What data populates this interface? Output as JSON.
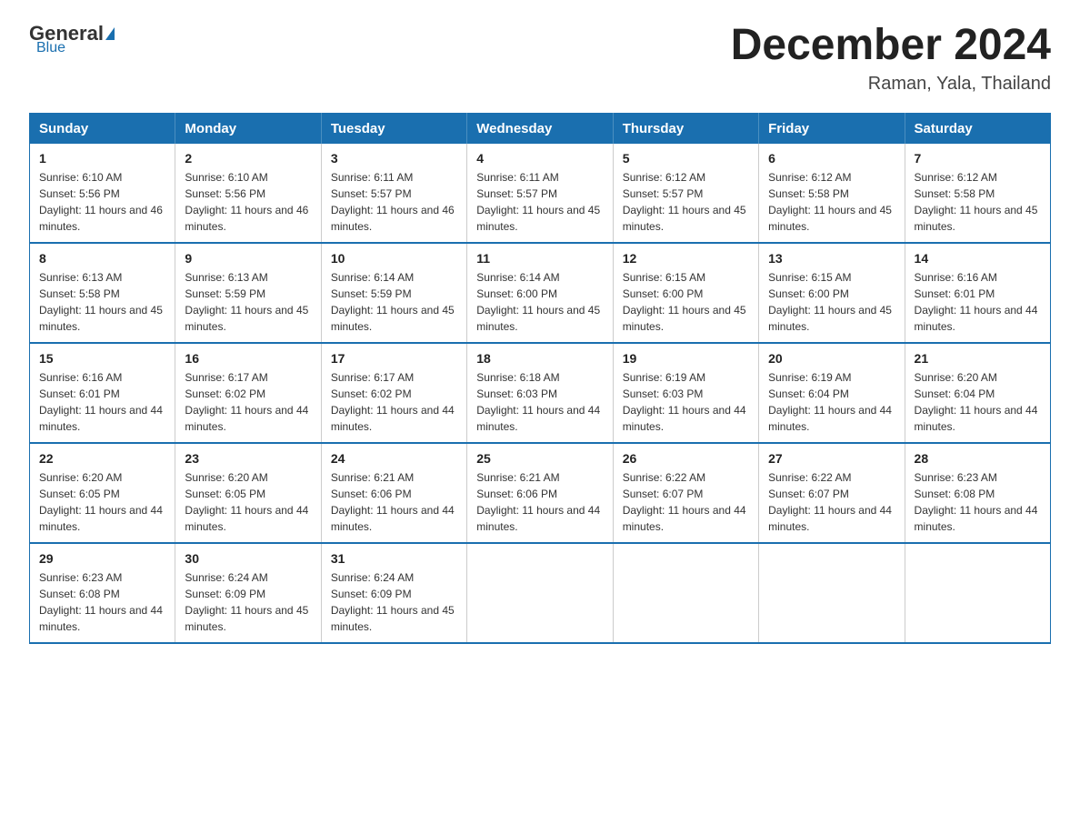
{
  "header": {
    "logo_general": "General",
    "logo_blue": "Blue",
    "month_title": "December 2024",
    "location": "Raman, Yala, Thailand"
  },
  "days_of_week": [
    "Sunday",
    "Monday",
    "Tuesday",
    "Wednesday",
    "Thursday",
    "Friday",
    "Saturday"
  ],
  "weeks": [
    [
      {
        "day": "1",
        "sunrise": "6:10 AM",
        "sunset": "5:56 PM",
        "daylight": "11 hours and 46 minutes."
      },
      {
        "day": "2",
        "sunrise": "6:10 AM",
        "sunset": "5:56 PM",
        "daylight": "11 hours and 46 minutes."
      },
      {
        "day": "3",
        "sunrise": "6:11 AM",
        "sunset": "5:57 PM",
        "daylight": "11 hours and 46 minutes."
      },
      {
        "day": "4",
        "sunrise": "6:11 AM",
        "sunset": "5:57 PM",
        "daylight": "11 hours and 45 minutes."
      },
      {
        "day": "5",
        "sunrise": "6:12 AM",
        "sunset": "5:57 PM",
        "daylight": "11 hours and 45 minutes."
      },
      {
        "day": "6",
        "sunrise": "6:12 AM",
        "sunset": "5:58 PM",
        "daylight": "11 hours and 45 minutes."
      },
      {
        "day": "7",
        "sunrise": "6:12 AM",
        "sunset": "5:58 PM",
        "daylight": "11 hours and 45 minutes."
      }
    ],
    [
      {
        "day": "8",
        "sunrise": "6:13 AM",
        "sunset": "5:58 PM",
        "daylight": "11 hours and 45 minutes."
      },
      {
        "day": "9",
        "sunrise": "6:13 AM",
        "sunset": "5:59 PM",
        "daylight": "11 hours and 45 minutes."
      },
      {
        "day": "10",
        "sunrise": "6:14 AM",
        "sunset": "5:59 PM",
        "daylight": "11 hours and 45 minutes."
      },
      {
        "day": "11",
        "sunrise": "6:14 AM",
        "sunset": "6:00 PM",
        "daylight": "11 hours and 45 minutes."
      },
      {
        "day": "12",
        "sunrise": "6:15 AM",
        "sunset": "6:00 PM",
        "daylight": "11 hours and 45 minutes."
      },
      {
        "day": "13",
        "sunrise": "6:15 AM",
        "sunset": "6:00 PM",
        "daylight": "11 hours and 45 minutes."
      },
      {
        "day": "14",
        "sunrise": "6:16 AM",
        "sunset": "6:01 PM",
        "daylight": "11 hours and 44 minutes."
      }
    ],
    [
      {
        "day": "15",
        "sunrise": "6:16 AM",
        "sunset": "6:01 PM",
        "daylight": "11 hours and 44 minutes."
      },
      {
        "day": "16",
        "sunrise": "6:17 AM",
        "sunset": "6:02 PM",
        "daylight": "11 hours and 44 minutes."
      },
      {
        "day": "17",
        "sunrise": "6:17 AM",
        "sunset": "6:02 PM",
        "daylight": "11 hours and 44 minutes."
      },
      {
        "day": "18",
        "sunrise": "6:18 AM",
        "sunset": "6:03 PM",
        "daylight": "11 hours and 44 minutes."
      },
      {
        "day": "19",
        "sunrise": "6:19 AM",
        "sunset": "6:03 PM",
        "daylight": "11 hours and 44 minutes."
      },
      {
        "day": "20",
        "sunrise": "6:19 AM",
        "sunset": "6:04 PM",
        "daylight": "11 hours and 44 minutes."
      },
      {
        "day": "21",
        "sunrise": "6:20 AM",
        "sunset": "6:04 PM",
        "daylight": "11 hours and 44 minutes."
      }
    ],
    [
      {
        "day": "22",
        "sunrise": "6:20 AM",
        "sunset": "6:05 PM",
        "daylight": "11 hours and 44 minutes."
      },
      {
        "day": "23",
        "sunrise": "6:20 AM",
        "sunset": "6:05 PM",
        "daylight": "11 hours and 44 minutes."
      },
      {
        "day": "24",
        "sunrise": "6:21 AM",
        "sunset": "6:06 PM",
        "daylight": "11 hours and 44 minutes."
      },
      {
        "day": "25",
        "sunrise": "6:21 AM",
        "sunset": "6:06 PM",
        "daylight": "11 hours and 44 minutes."
      },
      {
        "day": "26",
        "sunrise": "6:22 AM",
        "sunset": "6:07 PM",
        "daylight": "11 hours and 44 minutes."
      },
      {
        "day": "27",
        "sunrise": "6:22 AM",
        "sunset": "6:07 PM",
        "daylight": "11 hours and 44 minutes."
      },
      {
        "day": "28",
        "sunrise": "6:23 AM",
        "sunset": "6:08 PM",
        "daylight": "11 hours and 44 minutes."
      }
    ],
    [
      {
        "day": "29",
        "sunrise": "6:23 AM",
        "sunset": "6:08 PM",
        "daylight": "11 hours and 44 minutes."
      },
      {
        "day": "30",
        "sunrise": "6:24 AM",
        "sunset": "6:09 PM",
        "daylight": "11 hours and 45 minutes."
      },
      {
        "day": "31",
        "sunrise": "6:24 AM",
        "sunset": "6:09 PM",
        "daylight": "11 hours and 45 minutes."
      },
      null,
      null,
      null,
      null
    ]
  ],
  "labels": {
    "sunrise": "Sunrise:",
    "sunset": "Sunset:",
    "daylight": "Daylight:"
  },
  "colors": {
    "header_bg": "#1a6faf",
    "header_text": "#ffffff",
    "border": "#1a6faf"
  }
}
